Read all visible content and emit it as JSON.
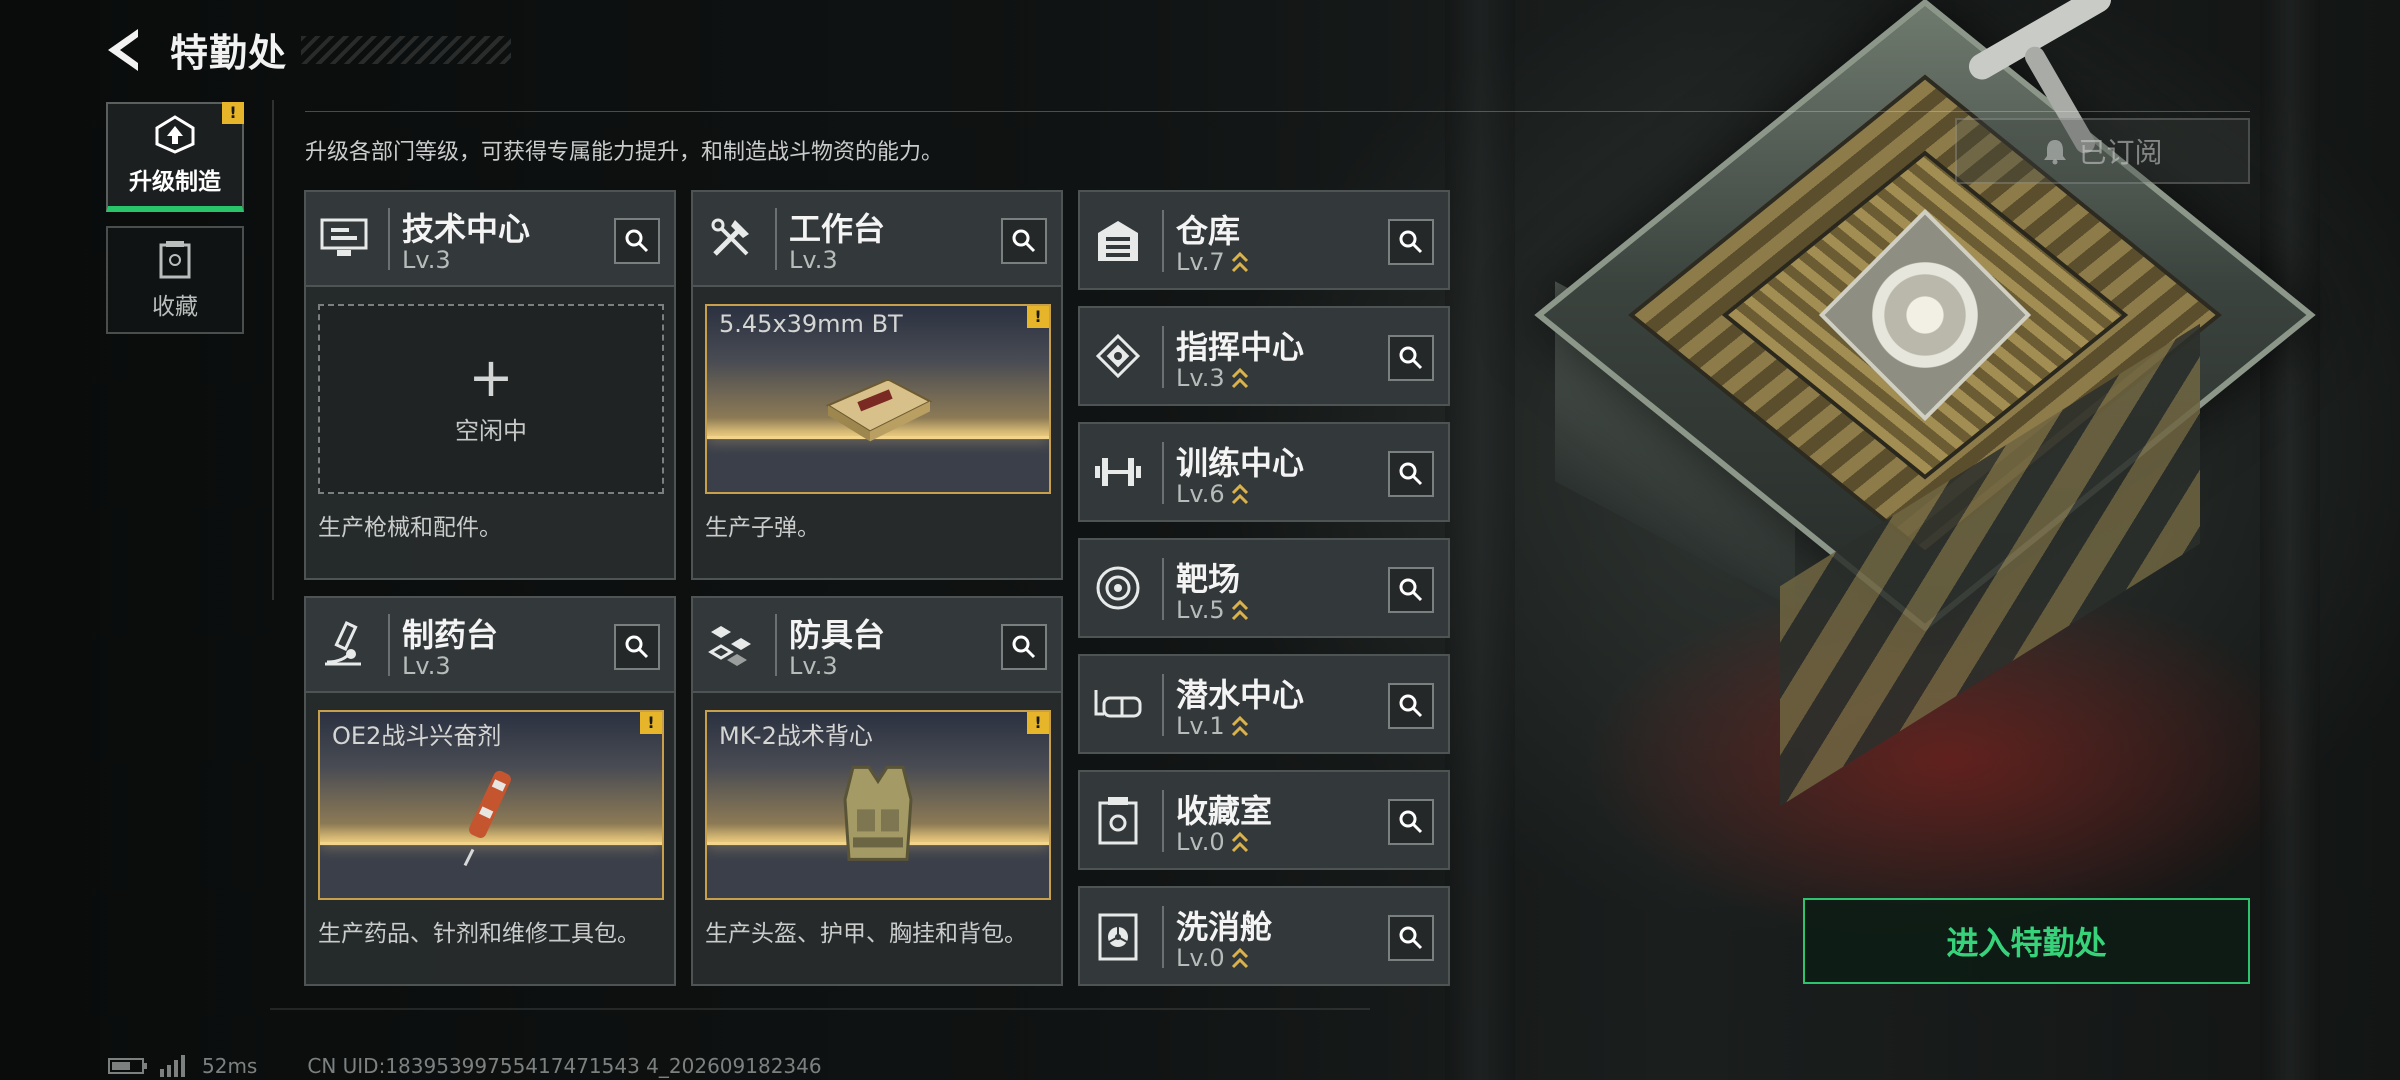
{
  "header": {
    "title": "特勤处",
    "back_icon": "back-arrow-icon"
  },
  "subtitle": "升级各部门等级，可获得专属能力提升，和制造战斗物资的能力。",
  "nav": {
    "items": [
      {
        "label": "升级制造",
        "icon": "upgrade-icon",
        "active": true,
        "alert": "!"
      },
      {
        "label": "收藏",
        "icon": "collection-icon",
        "active": false
      }
    ]
  },
  "production": [
    {
      "name": "技术中心",
      "level": "Lv.3",
      "icon": "tech-center-icon",
      "status": "idle",
      "idle_text": "空闲中",
      "plus": "+",
      "desc": "生产枪械和配件。"
    },
    {
      "name": "工作台",
      "level": "Lv.3",
      "icon": "workbench-icon",
      "status": "busy",
      "item": "5.45x39mm BT",
      "alert": "!",
      "desc": "生产子弹。"
    },
    {
      "name": "制药台",
      "level": "Lv.3",
      "icon": "pharmacy-icon",
      "status": "busy",
      "item": "OE2战斗兴奋剂",
      "alert": "!",
      "desc": "生产药品、针剂和维修工具包。"
    },
    {
      "name": "防具台",
      "level": "Lv.3",
      "icon": "armor-bench-icon",
      "status": "busy",
      "item": "MK-2战术背心",
      "alert": "!",
      "desc": "生产头盔、护甲、胸挂和背包。"
    }
  ],
  "facilities": [
    {
      "name": "仓库",
      "level": "Lv.7",
      "icon": "warehouse-icon"
    },
    {
      "name": "指挥中心",
      "level": "Lv.3",
      "icon": "command-center-icon"
    },
    {
      "name": "训练中心",
      "level": "Lv.6",
      "icon": "dumbbell-icon"
    },
    {
      "name": "靶场",
      "level": "Lv.5",
      "icon": "target-icon"
    },
    {
      "name": "潜水中心",
      "level": "Lv.1",
      "icon": "diving-mask-icon"
    },
    {
      "name": "收藏室",
      "level": "Lv.0",
      "icon": "collection-room-icon"
    },
    {
      "name": "洗消舱",
      "level": "Lv.0",
      "icon": "decontamination-icon"
    }
  ],
  "buttons": {
    "subscribed": "已订阅",
    "enter": "进入特勤处"
  },
  "footer": {
    "ping": "52ms",
    "uid": "CN UID:18395399755417471543 4_202609182346"
  },
  "colors": {
    "accent_green": "#2ec46f",
    "alert_yellow": "#e6b52a",
    "slot_gold": "#c89f4a"
  }
}
